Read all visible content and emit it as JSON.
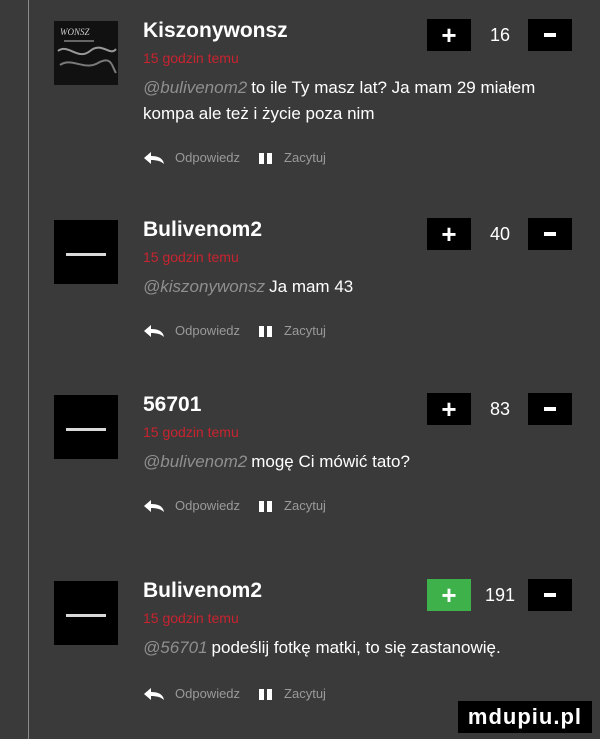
{
  "comments": [
    {
      "author": "Kiszonywonsz",
      "time": "15 godzin temu",
      "mention": "@bulivenom2",
      "text": "to ile Ty masz lat? Ja mam 29 miałem kompa ale też i życie poza nim",
      "score": "16",
      "upvoted": false,
      "avatar": "art"
    },
    {
      "author": "Bulivenom2",
      "time": "15 godzin temu",
      "mention": "@kiszonywonsz",
      "text": "Ja mam 43",
      "score": "40",
      "upvoted": false,
      "avatar": "black"
    },
    {
      "author": "56701",
      "time": "15 godzin temu",
      "mention": "@bulivenom2",
      "text": "mogę Ci mówić tato?",
      "score": "83",
      "upvoted": false,
      "avatar": "black"
    },
    {
      "author": "Bulivenom2",
      "time": "15 godzin temu",
      "mention": "@56701",
      "text": "podeślij fotkę matki, to się zastanowię.",
      "score": "191",
      "upvoted": true,
      "avatar": "black"
    }
  ],
  "labels": {
    "reply": "Odpowiedz",
    "quote": "Zacytuj",
    "plus": "+"
  },
  "avatar_art_text": "WONSZ",
  "watermark": "mdupiu.pl",
  "colors": {
    "background": "#3a3a3a",
    "time_red": "#c8242f",
    "upvote_active": "#3fb14a",
    "mention_grey": "#8f8f8f"
  }
}
